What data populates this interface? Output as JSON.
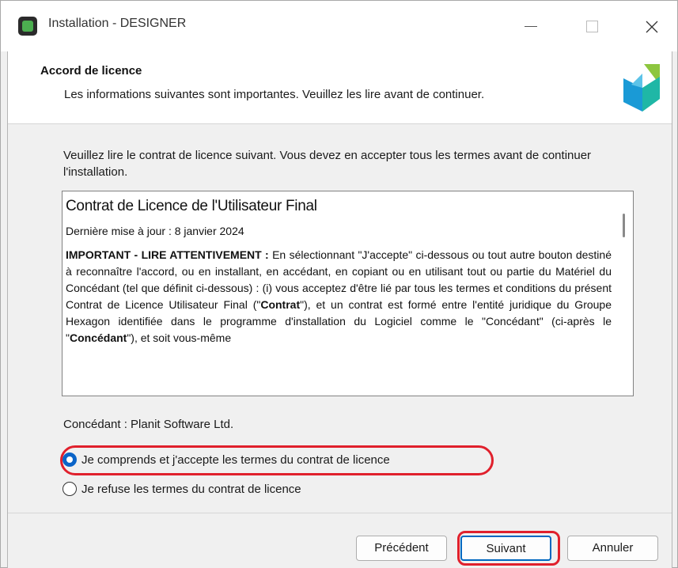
{
  "window": {
    "title": "Installation - DESIGNER"
  },
  "header": {
    "title": "Accord de licence",
    "subtitle": "Les informations suivantes sont importantes. Veuillez les lire avant de continuer."
  },
  "main": {
    "intro": "Veuillez lire le contrat de licence suivant. Vous devez en accepter tous les termes avant de continuer l'installation.",
    "license": {
      "title": "Contrat de Licence de l'Utilisateur Final",
      "date": "Dernière mise à jour : 8 janvier 2024",
      "body_lead": "IMPORTANT - LIRE ATTENTIVEMENT :",
      "body_part1": " En sélectionnant \"J'accepte\" ci-dessous ou tout autre bouton destiné à reconnaître l'accord, ou en installant, en accédant, en copiant ou en utilisant tout ou partie du Matériel du Concédant (tel que définit ci-dessous) : (i) vous acceptez d'être lié par tous les termes et conditions du présent Contrat de Licence Utilisateur Final (\"",
      "body_bold1": "Contrat",
      "body_part2": "\"), et un contrat est formé entre l'entité juridique du Groupe Hexagon identifiée dans le programme d'installation du Logiciel comme le \"Concédant\" (ci-après le \"",
      "body_bold2": "Concédant",
      "body_part3": "\"), et soit vous-même"
    },
    "licensor": "Concédant : Planit Software Ltd.",
    "options": {
      "accept": "Je comprends et j'accepte les termes du contrat de licence",
      "refuse": "Je refuse les termes du contrat de licence",
      "selected": "accept"
    }
  },
  "footer": {
    "back": "Précédent",
    "next": "Suivant",
    "cancel": "Annuler"
  },
  "colors": {
    "accent": "#0067c0",
    "annotation": "#e0202c",
    "logo_green": "#8dc63f",
    "logo_blue": "#1a9ad6",
    "logo_teal": "#1fb7a6"
  }
}
